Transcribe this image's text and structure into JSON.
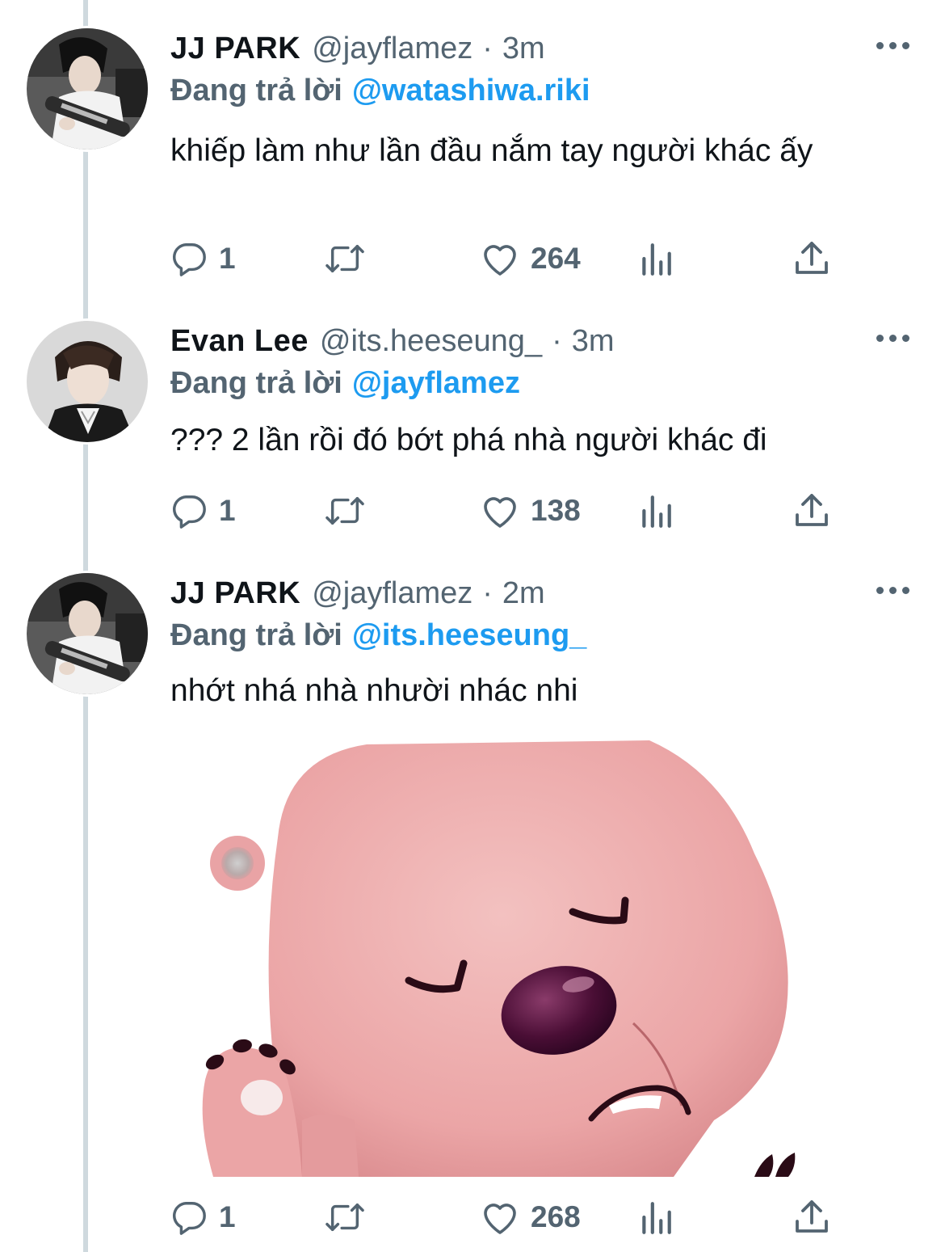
{
  "colors": {
    "text_primary": "#0f1419",
    "text_secondary": "#536471",
    "accent_blue": "#1d9bf0",
    "thread_line": "#cfd9de"
  },
  "tweets": [
    {
      "name": "JJ PARK",
      "handle": "@jayflamez",
      "separator": "·",
      "time": "3m",
      "replying_label": "Đang trả lời",
      "replying_to": "@watashiwa.riki",
      "text": "khiếp làm như lần đầu nắm tay người khác ấy",
      "replies": "1",
      "likes": "264",
      "avatar_icon": "avatar-photo-guitar"
    },
    {
      "name": "Evan Lee",
      "handle": "@its.heeseung_",
      "separator": "·",
      "time": "3m",
      "replying_label": "Đang trả lời",
      "replying_to": "@jayflamez",
      "text": "??? 2 lần rồi đó bớt phá nhà người khác đi",
      "replies": "1",
      "likes": "138",
      "avatar_icon": "avatar-photo-portrait"
    },
    {
      "name": "JJ PARK",
      "handle": "@jayflamez",
      "separator": "·",
      "time": "2m",
      "replying_label": "Đang trả lời",
      "replying_to": "@its.heeseung_",
      "text": "nhớt nhá nhà nhười nhác nhi",
      "replies": "1",
      "likes": "268",
      "avatar_icon": "avatar-photo-guitar",
      "media_icon": "pink-beaver-sticker"
    }
  ],
  "icons": {
    "reply": "reply-icon",
    "retweet": "retweet-icon",
    "like": "heart-icon",
    "views": "analytics-icon",
    "share": "share-icon",
    "more": "more-dots-icon"
  }
}
